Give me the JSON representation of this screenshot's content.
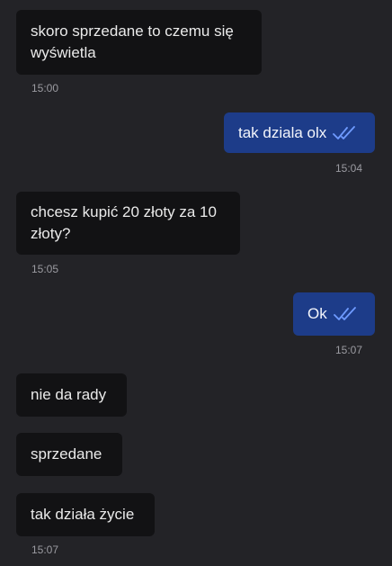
{
  "messages": [
    {
      "direction": "in",
      "text": "skoro sprzedane to czemu się\nwyświetla",
      "time": "15:00"
    },
    {
      "direction": "out",
      "text": "tak dziala olx",
      "time": "15:04",
      "status": "read-double-check-icon"
    },
    {
      "direction": "in",
      "text": "chcesz kupić 20 złoty za 10\nzłoty?",
      "time": "15:05"
    },
    {
      "direction": "out",
      "text": "Ok",
      "time": "15:07",
      "status": "read-double-check-icon"
    },
    {
      "direction": "in",
      "text": "nie da rady",
      "time": ""
    },
    {
      "direction": "in",
      "text": "sprzedane",
      "time": ""
    },
    {
      "direction": "in",
      "text": "tak działa życie",
      "time": "15:07"
    }
  ],
  "colors": {
    "background": "#232327",
    "incoming_bubble": "#121214",
    "outgoing_bubble": "#1d3c89",
    "read_ticks": "#6f9bff",
    "timestamp": "#9b9ba1"
  }
}
